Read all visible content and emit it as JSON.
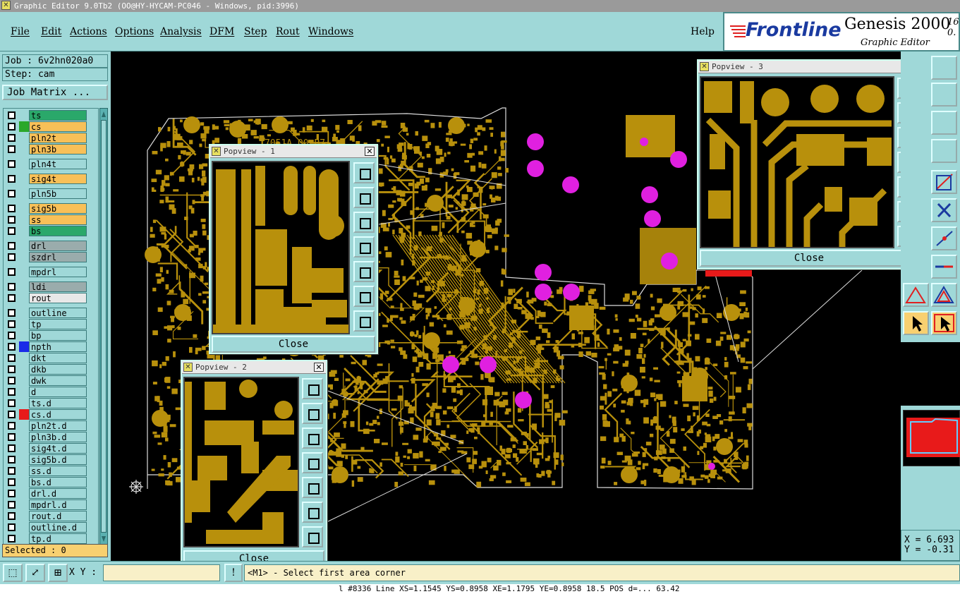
{
  "title_bar": {
    "text": "Graphic Editor 9.0Tb2 (OO@HY-HYCAM-PC046 - Windows, pid:3996)"
  },
  "menu": {
    "items": [
      "File",
      "Edit",
      "Actions",
      "Options",
      "Analysis",
      "DFM",
      "Step",
      "Rout",
      "Windows"
    ],
    "help": "Help"
  },
  "brand": {
    "logo": "Frontline",
    "product": "Genesis 2000",
    "subtitle": "Graphic Editor",
    "version": "16 0."
  },
  "job": {
    "label": "Job : 6v2hn020a0",
    "step": "Step: cam",
    "matrix_button": "Job Matrix ..."
  },
  "layers": [
    {
      "name": "ts",
      "color": "#2aa86a",
      "swatch": ""
    },
    {
      "name": "cs",
      "color": "#f8c058",
      "swatch": "#2aa82a"
    },
    {
      "name": "pln2t",
      "color": "#f8c058",
      "swatch": ""
    },
    {
      "name": "pln3b",
      "color": "#f8c058",
      "swatch": ""
    },
    {
      "name": "pln4t",
      "color": "#9fd8d8",
      "swatch": ""
    },
    {
      "name": "sig4t",
      "color": "#f8c058",
      "swatch": ""
    },
    {
      "name": "pln5b",
      "color": "#9fd8d8",
      "swatch": ""
    },
    {
      "name": "sig5b",
      "color": "#f8c058",
      "swatch": ""
    },
    {
      "name": "ss",
      "color": "#f8c058",
      "swatch": ""
    },
    {
      "name": "bs",
      "color": "#2aa86a",
      "swatch": ""
    },
    {
      "name": "drl",
      "color": "#9aacac",
      "swatch": ""
    },
    {
      "name": "szdrl",
      "color": "#9aacac",
      "swatch": ""
    },
    {
      "name": "mpdrl",
      "color": "#9fd8d8",
      "swatch": ""
    },
    {
      "name": "ldi",
      "color": "#9aacac",
      "swatch": ""
    },
    {
      "name": "rout",
      "color": "#e8e8e8",
      "swatch": ""
    },
    {
      "name": "outline",
      "color": "#9fd8d8",
      "swatch": ""
    },
    {
      "name": "tp",
      "color": "#9fd8d8",
      "swatch": ""
    },
    {
      "name": "bp",
      "color": "#9fd8d8",
      "swatch": ""
    },
    {
      "name": "npth",
      "color": "#9fd8d8",
      "swatch": "#1a2ae8"
    },
    {
      "name": "dkt",
      "color": "#9fd8d8",
      "swatch": ""
    },
    {
      "name": "dkb",
      "color": "#9fd8d8",
      "swatch": ""
    },
    {
      "name": "dwk",
      "color": "#9fd8d8",
      "swatch": ""
    },
    {
      "name": "d",
      "color": "#9fd8d8",
      "swatch": ""
    },
    {
      "name": "ts.d",
      "color": "#9fd8d8",
      "swatch": ""
    },
    {
      "name": "cs.d",
      "color": "#9fd8d8",
      "swatch": "#e81a1a"
    },
    {
      "name": "pln2t.d",
      "color": "#9fd8d8",
      "swatch": ""
    },
    {
      "name": "pln3b.d",
      "color": "#9fd8d8",
      "swatch": ""
    },
    {
      "name": "sig4t.d",
      "color": "#9fd8d8",
      "swatch": ""
    },
    {
      "name": "sig5b.d",
      "color": "#9fd8d8",
      "swatch": ""
    },
    {
      "name": "ss.d",
      "color": "#9fd8d8",
      "swatch": ""
    },
    {
      "name": "bs.d",
      "color": "#9fd8d8",
      "swatch": ""
    },
    {
      "name": "drl.d",
      "color": "#9fd8d8",
      "swatch": ""
    },
    {
      "name": "mpdrl.d",
      "color": "#9fd8d8",
      "swatch": ""
    },
    {
      "name": "rout.d",
      "color": "#9fd8d8",
      "swatch": ""
    },
    {
      "name": "outline.d",
      "color": "#9fd8d8",
      "swatch": ""
    },
    {
      "name": "tp.d",
      "color": "#9fd8d8",
      "swatch": ""
    }
  ],
  "selected": "Selected : 0",
  "popviews": [
    {
      "title": "Popview - 1",
      "close": "Close"
    },
    {
      "title": "Popview - 2",
      "close": "Close"
    },
    {
      "title": "Popview - 3",
      "close": "Close"
    }
  ],
  "coords": {
    "x": "X = 6.693",
    "y": "Y = -0.31"
  },
  "bottom": {
    "xy_label": "X Y :",
    "xy_value": "",
    "prompt": "<M1> - Select first area corner"
  },
  "status": "l #8336 Line XS=1.1545 YS=0.8958 XE=1.1795 YE=0.8958 18.5 POS d=... 63.42",
  "pcb": {
    "label": "7051A 00 B7",
    "copper": "#b8900c",
    "via": "#e020e0"
  }
}
